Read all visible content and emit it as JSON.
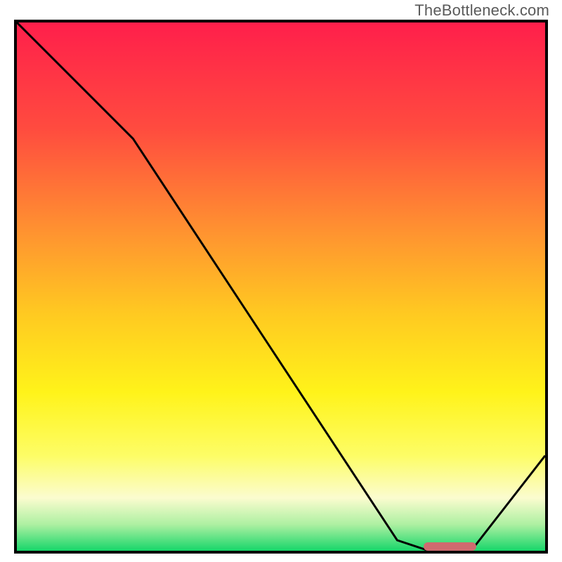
{
  "watermark": "TheBottleneck.com",
  "chart_data": {
    "type": "line",
    "title": "",
    "xlabel": "",
    "ylabel": "",
    "xlim": [
      0,
      100
    ],
    "ylim": [
      0,
      100
    ],
    "grid": false,
    "legend": false,
    "background_gradient_stops": [
      {
        "pct": 0,
        "color": "#ff1f4b"
      },
      {
        "pct": 20,
        "color": "#ff4b3f"
      },
      {
        "pct": 40,
        "color": "#ff9430"
      },
      {
        "pct": 55,
        "color": "#ffc921"
      },
      {
        "pct": 70,
        "color": "#fff31a"
      },
      {
        "pct": 82,
        "color": "#fdfd66"
      },
      {
        "pct": 90,
        "color": "#fbfccf"
      },
      {
        "pct": 95,
        "color": "#aef0a2"
      },
      {
        "pct": 100,
        "color": "#17d66a"
      }
    ],
    "series": [
      {
        "name": "bottleneck-curve",
        "color": "#000000",
        "stroke_width": 3,
        "x": [
          0,
          22,
          72,
          78,
          86,
          100
        ],
        "y": [
          100,
          78,
          2,
          0,
          0,
          18
        ]
      }
    ],
    "marker": {
      "name": "optimal-range",
      "color": "#cf6a6f",
      "x_start": 77,
      "x_end": 87,
      "y": 0,
      "height_pct": 1.6
    }
  }
}
